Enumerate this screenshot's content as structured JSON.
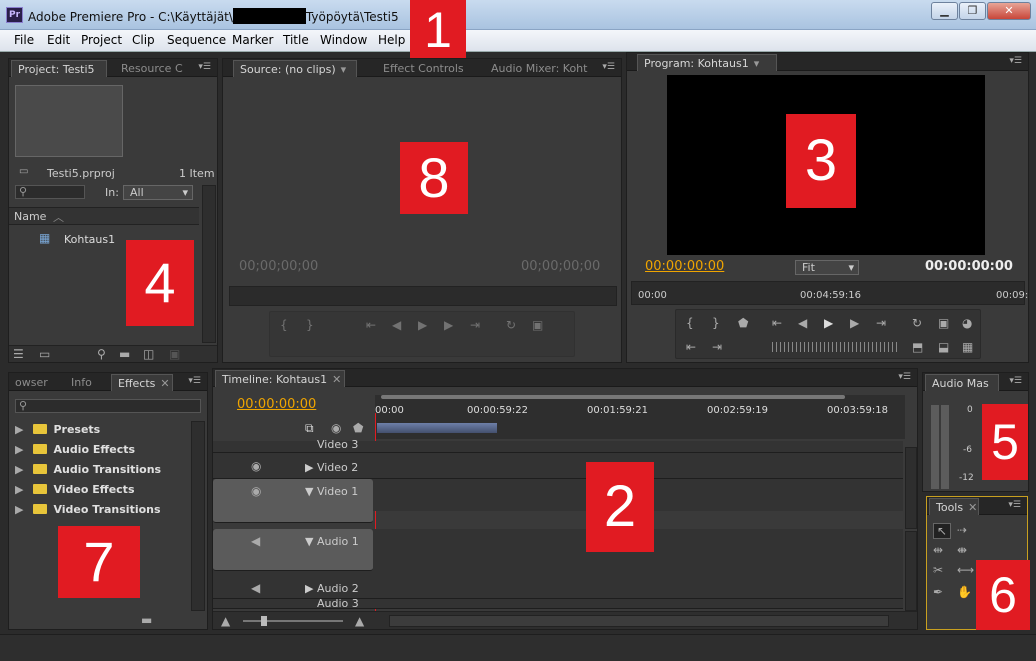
{
  "window": {
    "app_name": "Adobe Premiere Pro",
    "path_prefix": "C:\\Käyttäjät\\",
    "path_suffix": "Työpöytä\\Testi5",
    "logo": "Pr",
    "minimize": "▁",
    "restore": "❐",
    "close": "✕"
  },
  "menu": [
    "File",
    "Edit",
    "Project",
    "Clip",
    "Sequence",
    "Marker",
    "Title",
    "Window",
    "Help"
  ],
  "markers": [
    "1",
    "2",
    "3",
    "4",
    "5",
    "6",
    "7",
    "8"
  ],
  "project": {
    "tabs": [
      "Project: Testi5",
      "Resource C"
    ],
    "file": "Testi5.prproj",
    "count": "1 Item",
    "in_label": "In:",
    "in_value": "All",
    "column": "Name",
    "item": "Kohtaus1"
  },
  "source": {
    "tabs": [
      "Source: (no clips)",
      "Effect Controls",
      "Audio Mixer: Koht"
    ],
    "tc_left": "00;00;00;00",
    "tc_right": "00;00;00;00"
  },
  "program": {
    "tab": "Program: Kohtaus1",
    "tc_left": "00:00:00:00",
    "fit": "Fit",
    "tc_right": "00:00:00:00",
    "ruler": [
      "00:00",
      "00:04:59:16",
      "00:09:"
    ]
  },
  "effects": {
    "tabs": [
      "owser",
      "Info",
      "Effects"
    ],
    "items": [
      "Presets",
      "Audio Effects",
      "Audio Transitions",
      "Video Effects",
      "Video Transitions"
    ]
  },
  "timeline": {
    "tab": "Timeline: Kohtaus1",
    "tc": "00:00:00:00",
    "ruler": [
      "00:00",
      "00:00:59:22",
      "00:01:59:21",
      "00:02:59:19",
      "00:03:59:18"
    ],
    "tracks": [
      "Video 3",
      "Video 2",
      "Video 1",
      "Audio 1",
      "Audio 2",
      "Audio 3"
    ]
  },
  "audio_master": {
    "tab": "Audio Mas",
    "levels": [
      "0",
      "-6",
      "-12"
    ]
  },
  "tools": {
    "tab": "Tools"
  },
  "colors": {
    "timecode_orange": "#f0a500",
    "marker_red": "#e11b22",
    "folder_yellow": "#e8c53a"
  }
}
